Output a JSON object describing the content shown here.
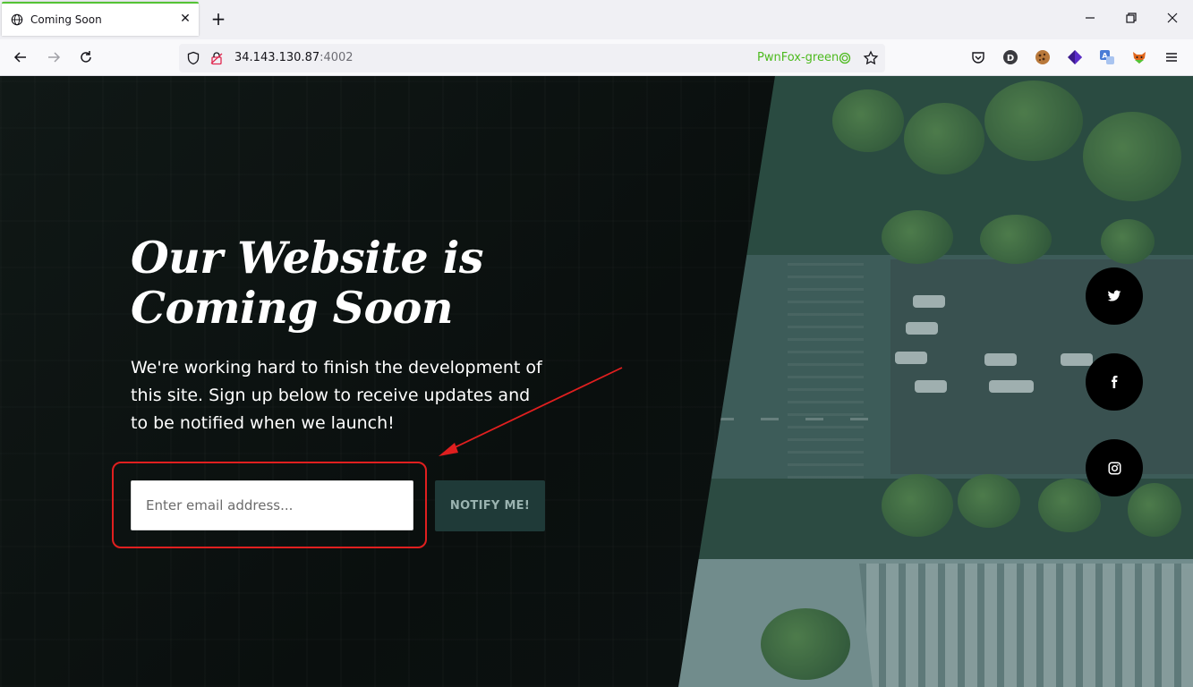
{
  "browser": {
    "tab": {
      "title": "Coming Soon",
      "close_glyph": "✕"
    },
    "new_tab_glyph": "+",
    "url": {
      "host": "34.143.130.87",
      "port": ":4002"
    },
    "container_label": "PwnFox-green",
    "accent_color": "#54c334",
    "extensions": [
      "pocket-icon",
      "d-extension-icon",
      "cookie-icon",
      "diamond-extension-icon",
      "translate-icon",
      "fox-icon",
      "menu-icon"
    ]
  },
  "hero": {
    "headline_line1": "Our Website is",
    "headline_line2": "Coming Soon",
    "description": "We're working hard to finish the development of this site. Sign up below to receive updates and to be notified when we launch!"
  },
  "signup": {
    "email_placeholder": "Enter email address...",
    "button_label": "NOTIFY ME!"
  },
  "social": [
    "twitter-icon",
    "facebook-icon",
    "instagram-icon"
  ],
  "annotation": {
    "color": "#e01f1f"
  }
}
